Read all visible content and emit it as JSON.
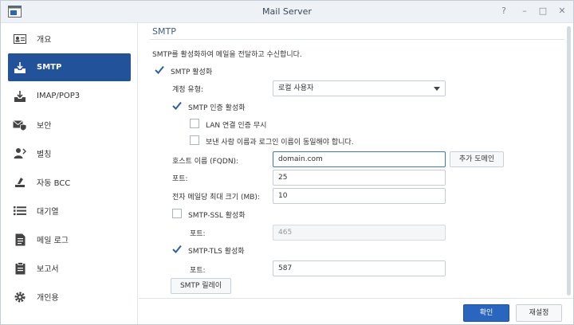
{
  "window": {
    "title": "Mail Server"
  },
  "titlebar": {
    "help": "?",
    "minimize": "–",
    "maximize": "□",
    "close": "✕"
  },
  "sidebar": {
    "items": [
      {
        "label": "개요"
      },
      {
        "label": "SMTP"
      },
      {
        "label": "IMAP/POP3"
      },
      {
        "label": "보안"
      },
      {
        "label": "별칭"
      },
      {
        "label": "자동 BCC"
      },
      {
        "label": "대기열"
      },
      {
        "label": "메일 로그"
      },
      {
        "label": "보고서"
      },
      {
        "label": "개인용"
      }
    ]
  },
  "smtp": {
    "section_title": "SMTP",
    "description": "SMTP를 활성화하여 메일을 전달하고 수신합니다.",
    "enable_smtp": {
      "label": "SMTP 활성화",
      "checked": true
    },
    "account_type": {
      "label": "계정 유형:",
      "value": "로컬 사용자"
    },
    "smtp_auth": {
      "label": "SMTP 인증 활성화",
      "checked": true
    },
    "ignore_lan_auth": {
      "label": "LAN 연결 인증 무시",
      "checked": false
    },
    "sender_match": {
      "label": "보낸 사람 이름과 로그인 이름이 동일해야 합니다.",
      "checked": false
    },
    "hostname": {
      "label": "호스트 이름 (FQDN):",
      "value": "domain.com",
      "add_domain": "추가 도메인"
    },
    "port": {
      "label": "포트:",
      "value": "25"
    },
    "max_size": {
      "label": "전자 메일당 최대 크기 (MB):",
      "value": "10"
    },
    "smtp_ssl": {
      "label": "SMTP-SSL 활성화",
      "checked": false,
      "port_label": "포트:",
      "port_value": "465"
    },
    "smtp_tls": {
      "label": "SMTP-TLS 활성화",
      "checked": true,
      "port_label": "포트:",
      "port_value": "587"
    },
    "relay_button": "SMTP 릴레이"
  },
  "footer": {
    "apply": "확인",
    "reset": "재설정"
  }
}
